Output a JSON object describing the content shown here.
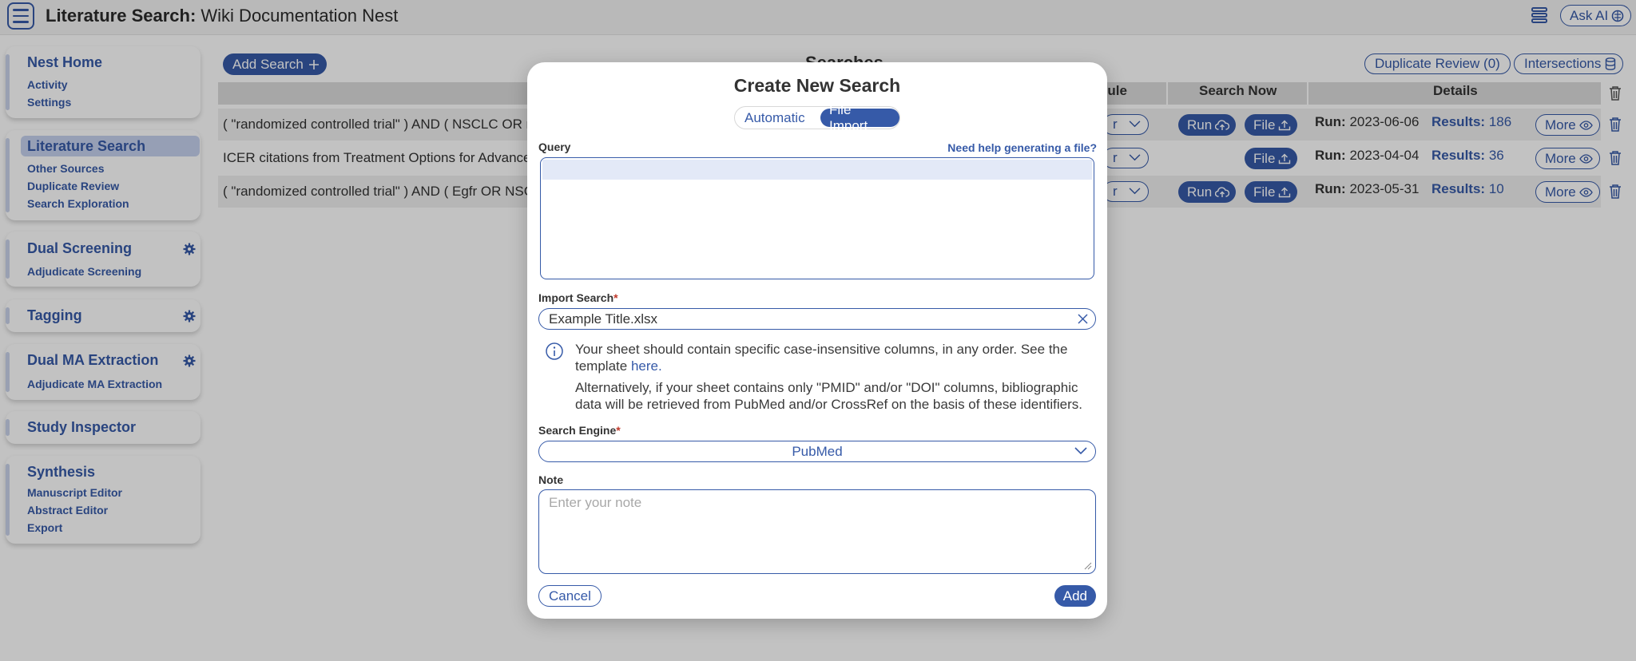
{
  "header": {
    "title_bold": "Literature Search:",
    "title_rest": " Wiki Documentation Nest",
    "ask_ai_label": "Ask AI"
  },
  "sidebar": {
    "sections": [
      {
        "title": "Nest Home",
        "items": [
          "Activity",
          "Settings"
        ]
      },
      {
        "title": "Literature Search",
        "items": [
          "Other Sources",
          "Duplicate Review",
          "Search Exploration"
        ]
      },
      {
        "title": "Dual Screening",
        "items": [
          "Adjudicate Screening"
        ]
      },
      {
        "title": "Tagging",
        "items": []
      },
      {
        "title": "Dual MA Extraction",
        "items": [
          "Adjudicate MA Extraction"
        ]
      },
      {
        "title": "Study Inspector",
        "items": []
      },
      {
        "title": "Synthesis",
        "items": [
          "Manuscript Editor",
          "Abstract Editor",
          "Export"
        ]
      }
    ]
  },
  "main": {
    "add_search_label": "Add Search",
    "title": "Searches",
    "duplicate_review_label": "Duplicate Review (0)",
    "intersections_label": "Intersections",
    "columns": {
      "schedule": "dule",
      "search_now": "Search Now",
      "details": "Details"
    },
    "run_label": "Run",
    "file_label": "File",
    "more_label": "More",
    "run_prefix": "Run:",
    "results_prefix": "Results:",
    "rows": [
      {
        "query": "( \"randomized controlled trial\" ) AND ( NSCLC OR n",
        "run_date": "2023-06-06",
        "results": "186",
        "schedule": "r"
      },
      {
        "query": "ICER citations from Treatment Options for Advance",
        "run_date": "2023-04-04",
        "results": "36",
        "schedule": "r"
      },
      {
        "query": "( \"randomized controlled trial\" ) AND ( Egfr OR NSC",
        "run_date": "2023-05-31",
        "results": "10",
        "schedule": "r"
      }
    ]
  },
  "modal": {
    "title": "Create New Search",
    "tab_automatic": "Automatic",
    "tab_file_import": "File Import",
    "query_label": "Query",
    "help_link": "Need help generating a file?",
    "import_label": "Import Search",
    "import_value": "Example Title.xlsx",
    "info_line1": "Your sheet should contain specific case-insensitive columns, in any order. See the template",
    "info_link": "here.",
    "info_line2": "Alternatively, if your sheet contains only \"PMID\" and/or \"DOI\" columns, bibliographic data will be retrieved from PubMed and/or CrossRef on the basis of these identifiers.",
    "engine_label": "Search Engine",
    "engine_value": "PubMed",
    "note_label": "Note",
    "note_placeholder": "Enter your note",
    "required_mark": "*",
    "cancel_label": "Cancel",
    "add_label": "Add"
  },
  "colors": {
    "accent": "#365aa8",
    "overlay": "rgba(0,0,0,0.24)",
    "active_nav": "#c6d2ee"
  },
  "icons": [
    "menu-icon",
    "stack-icon",
    "ai-brain-icon",
    "plus-icon",
    "database-icon",
    "gear-icon",
    "trash-icon",
    "cloud-upload-icon",
    "upload-icon",
    "eye-icon",
    "chevron-down-icon",
    "close-icon",
    "info-icon"
  ]
}
